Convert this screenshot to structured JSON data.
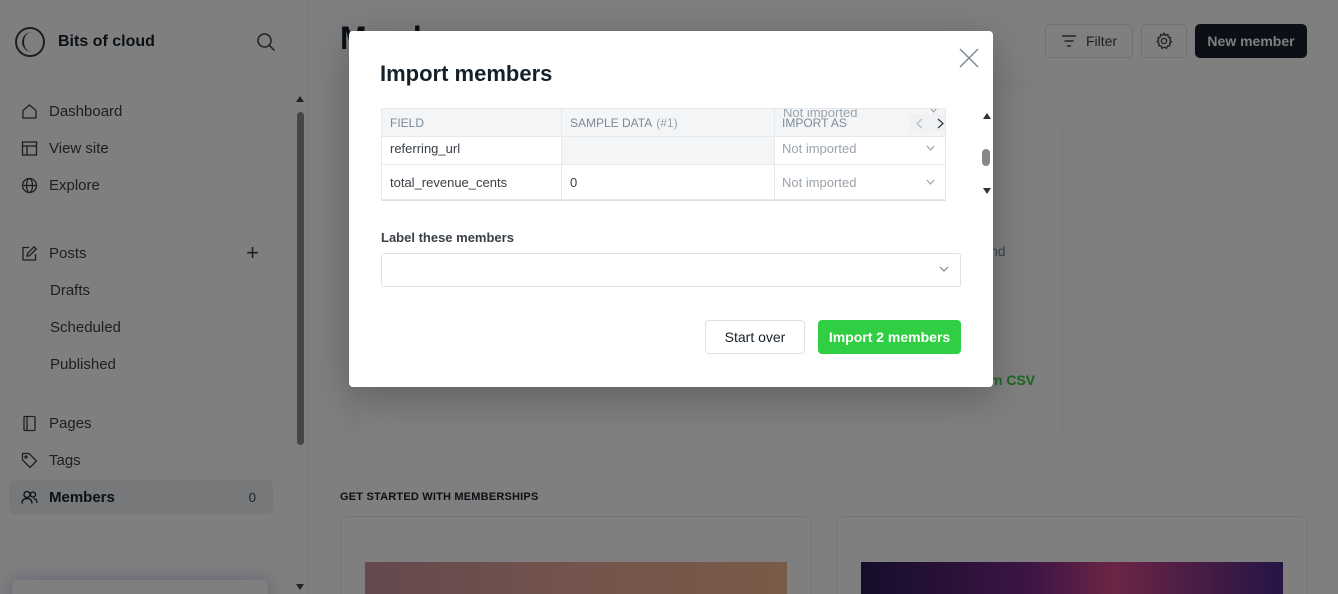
{
  "app": {
    "site_name": "Bits of cloud",
    "page_title": "Members"
  },
  "sidebar": {
    "items": [
      {
        "label": "Dashboard",
        "icon": "home-icon"
      },
      {
        "label": "View site",
        "icon": "layout-icon"
      },
      {
        "label": "Explore",
        "icon": "globe-icon"
      },
      {
        "label": "Posts",
        "icon": "edit-icon"
      },
      {
        "label": "Drafts"
      },
      {
        "label": "Scheduled"
      },
      {
        "label": "Published"
      },
      {
        "label": "Pages",
        "icon": "pages-icon"
      },
      {
        "label": "Tags",
        "icon": "tag-icon"
      },
      {
        "label": "Members",
        "icon": "members-icon",
        "count": "0",
        "active": true
      }
    ]
  },
  "toolbar": {
    "filter_label": "Filter",
    "new_member_label": "New member"
  },
  "background": {
    "partial_text": "nd",
    "import_csv_partial": "m CSV",
    "section_heading": "GET STARTED WITH MEMBERSHIPS"
  },
  "modal": {
    "title": "Import members",
    "table": {
      "headers": {
        "field": "FIELD",
        "sample_data": "SAMPLE DATA",
        "sample_index": "(#1)",
        "import_as": "IMPORT AS"
      },
      "ghost_select": "Not imported",
      "rows": [
        {
          "field": "referring_url",
          "sample": "",
          "import_as": "Not imported"
        },
        {
          "field": "total_revenue_cents",
          "sample": "0",
          "import_as": "Not imported"
        }
      ]
    },
    "label_section_title": "Label these members",
    "label_select_value": "",
    "start_over_label": "Start over",
    "import_label": "Import 2 members"
  },
  "colors": {
    "accent_green": "#30cf43",
    "dark": "#15212a"
  }
}
